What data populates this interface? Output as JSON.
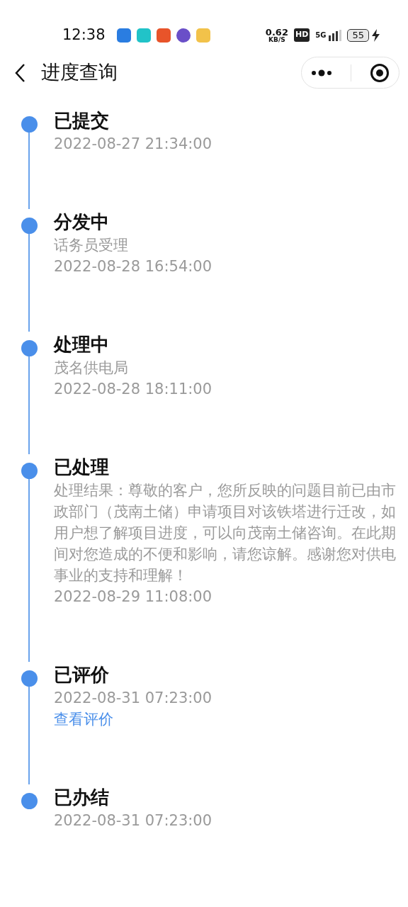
{
  "status_bar": {
    "time": "12:38",
    "net_speed": "0.62",
    "net_unit": "KB/S",
    "hd": "HD",
    "network": "5G",
    "battery": "55"
  },
  "header": {
    "title": "进度查询"
  },
  "steps": [
    {
      "title": "已提交",
      "date": "2022-08-27 21:34:00"
    },
    {
      "title": "分发中",
      "details": [
        "话务员受理"
      ],
      "date": "2022-08-28 16:54:00"
    },
    {
      "title": "处理中",
      "details": [
        "茂名供电局"
      ],
      "date": "2022-08-28 18:11:00"
    },
    {
      "title": "已处理",
      "details": [
        "处理结果：尊敬的客户，您所反映的问题目前已由市政部门（茂南土储）申请项目对该铁塔进行迁改，如用户想了解项目进度，可以向茂南土储咨询。在此期间对您造成的不便和影响，请您谅解。感谢您对供电事业的支持和理解！"
      ],
      "date": "2022-08-29 11:08:00"
    },
    {
      "title": "已评价",
      "date": "2022-08-31 07:23:00",
      "link": "查看评价"
    },
    {
      "title": "已办结",
      "date": "2022-08-31 07:23:00"
    }
  ]
}
